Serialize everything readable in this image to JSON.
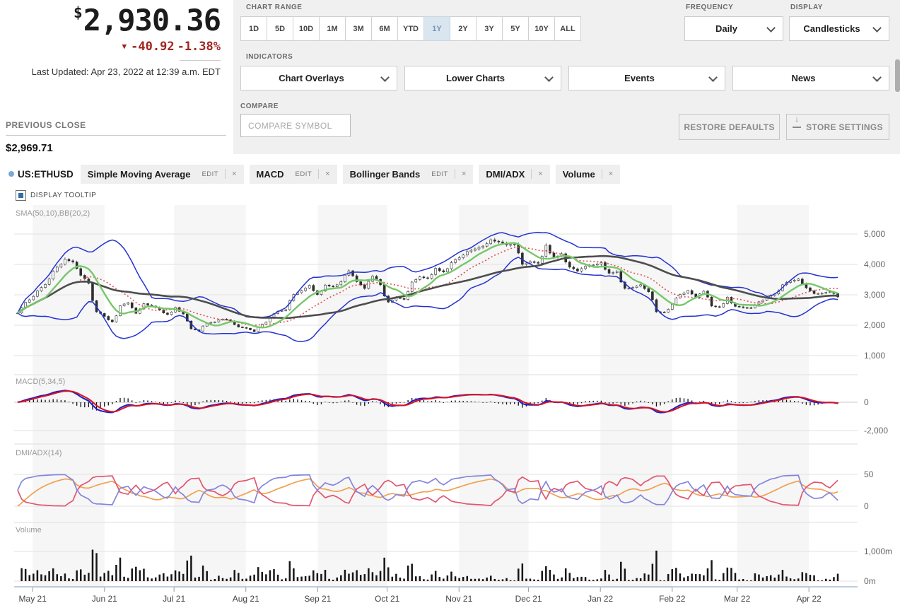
{
  "header": {
    "price_currency": "$",
    "price": "2,930.36",
    "change_arrow": "▼",
    "change": "-40.92",
    "change_pct": "-1.38%",
    "last_updated": "Last Updated: Apr 23, 2022 at 12:39 a.m. EDT"
  },
  "controls": {
    "chart_range_label": "CHART RANGE",
    "ranges": [
      "1D",
      "5D",
      "10D",
      "1M",
      "3M",
      "6M",
      "YTD",
      "1Y",
      "2Y",
      "3Y",
      "5Y",
      "10Y",
      "ALL"
    ],
    "selected_range": "1Y",
    "frequency_label": "FREQUENCY",
    "frequency_value": "Daily",
    "display_label": "DISPLAY",
    "display_value": "Candlesticks",
    "indicators_label": "INDICATORS",
    "indicator_dropdowns": [
      "Chart Overlays",
      "Lower Charts",
      "Events",
      "News"
    ],
    "compare_label": "COMPARE",
    "compare_placeholder": "COMPARE SYMBOL",
    "restore_defaults": "RESTORE DEFAULTS",
    "store_settings": "STORE SETTINGS"
  },
  "previous_close": {
    "label": "PREVIOUS CLOSE",
    "value": "$2,969.71"
  },
  "legend": {
    "symbol": "US:ETHUSD",
    "edit_label": "EDIT",
    "close_glyph": "×",
    "pills": [
      {
        "label": "Simple Moving Average",
        "edit": true
      },
      {
        "label": "MACD",
        "edit": true
      },
      {
        "label": "Bollinger Bands",
        "edit": true
      },
      {
        "label": "DMI/ADX",
        "edit": false
      },
      {
        "label": "Volume",
        "edit": false
      }
    ]
  },
  "tooltip_toggle": "DISPLAY TOOLTIP",
  "chart_data": {
    "type": "candlestick",
    "symbol": "US:ETHUSD",
    "x_labels": [
      "May 21",
      "Jun 21",
      "Jul 21",
      "Aug 21",
      "Sep 21",
      "Oct 21",
      "Nov 21",
      "Dec 21",
      "Jan 22",
      "Feb 22",
      "Mar 22",
      "Apr 22"
    ],
    "panels": [
      {
        "name": "price",
        "label": "SMA(50,10),BB(20,2)",
        "yticks": [
          "5,000",
          "4,000",
          "3,000",
          "2,000",
          "1,000"
        ],
        "ytick_values": [
          5000,
          4000,
          3000,
          2000,
          1000
        ]
      },
      {
        "name": "macd",
        "label": "MACD(5,34,5)",
        "yticks": [
          "0",
          "-2,000"
        ],
        "ytick_values": [
          0,
          -2000
        ]
      },
      {
        "name": "dmi",
        "label": "DMI/ADX(14)",
        "yticks": [
          "50",
          "0"
        ],
        "ytick_values": [
          50,
          0
        ]
      },
      {
        "name": "volume",
        "label": "Volume",
        "yticks": [
          "1,000m",
          "0m"
        ],
        "ytick_values": [
          1000,
          0
        ]
      }
    ],
    "close": [
      2400,
      2750,
      2950,
      3240,
      3520,
      3910,
      4170,
      4080,
      3640,
      3380,
      2440,
      2290,
      2110,
      2640,
      2740,
      2390,
      2710,
      2630,
      2500,
      2350,
      2580,
      2370,
      1880,
      1810,
      2080,
      2110,
      2200,
      2140,
      1940,
      1900,
      1790,
      2030,
      2230,
      2460,
      2510,
      3010,
      3140,
      3310,
      3010,
      3320,
      3270,
      3430,
      3790,
      3430,
      3210,
      3610,
      3330,
      2760,
      2930,
      2850,
      3420,
      3590,
      3540,
      3870,
      3750,
      4060,
      4220,
      4420,
      4510,
      4600,
      4810,
      4740,
      4640,
      4660,
      4000,
      4090,
      4040,
      4630,
      4230,
      4350,
      3910,
      3780,
      3940,
      3980,
      4060,
      3710,
      3770,
      3210,
      3240,
      3330,
      3100,
      2440,
      2430,
      2690,
      3010,
      3140,
      2920,
      3120,
      2630,
      2600,
      2920,
      2620,
      2580,
      2570,
      2770,
      2890,
      3030,
      3330,
      3450,
      3520,
      3230,
      3040,
      3050,
      3100,
      2930
    ],
    "colors": {
      "candle_up": "#ffffff",
      "candle_down": "#2e2e2e",
      "candle_wick": "#2e2e2e",
      "bollinger": "#2433d0",
      "sma_short": "#76c76a",
      "sma_mid": "#e05252",
      "sma_long": "#4d4d4d",
      "macd_line": "#1522cc",
      "macd_signal": "#dd1122",
      "adx": "#f0a050",
      "di_plus": "#8585dd",
      "di_minus": "#e25570",
      "volume": "#161616"
    }
  }
}
